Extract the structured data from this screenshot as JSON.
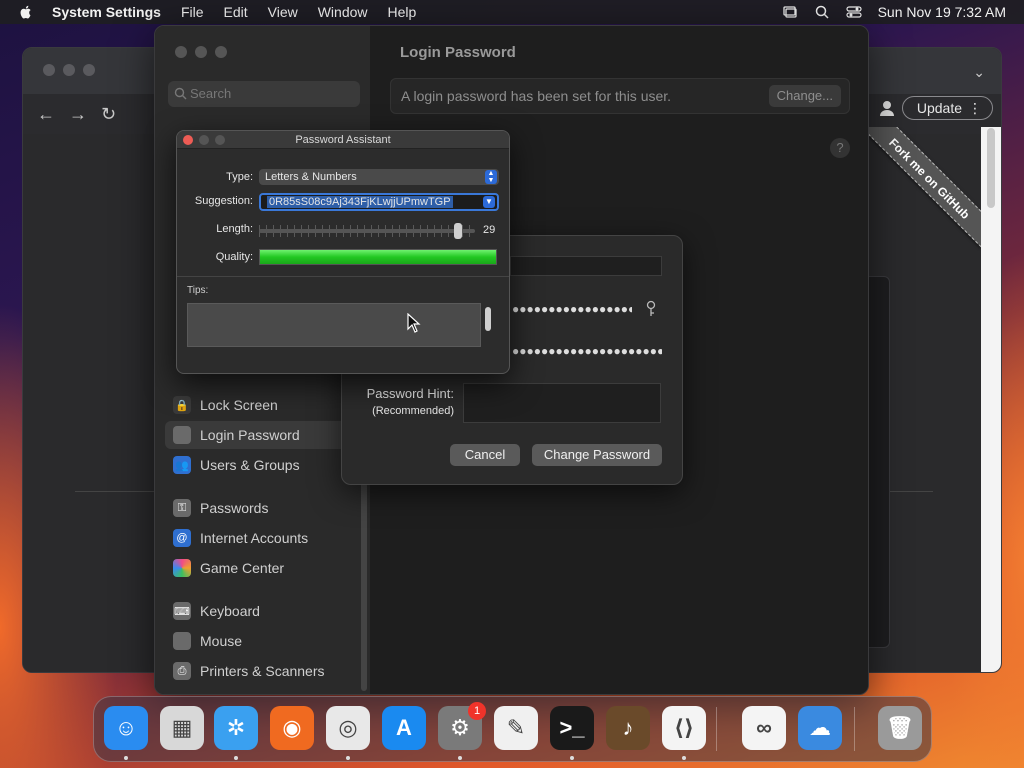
{
  "menubar": {
    "app_name": "System Settings",
    "items": [
      "File",
      "Edit",
      "View",
      "Window",
      "Help"
    ],
    "clock": "Sun Nov 19  7:32 AM"
  },
  "chrome": {
    "update_label": "Update",
    "ribbon_text": "Fork me on GitHub"
  },
  "settings": {
    "search_placeholder": "Search",
    "title": "Login Password",
    "info_text": "A login password has been set for this user.",
    "change_label": "Change...",
    "help_label": "?",
    "sidebar": [
      {
        "label": "Lock Screen",
        "icon": "lock-icon",
        "color": "#3a3a3a"
      },
      {
        "label": "Login Password",
        "icon": "key-icon",
        "color": "#6a6a6a",
        "selected": true
      },
      {
        "label": "Users & Groups",
        "icon": "users-icon",
        "color": "#2f6fd0"
      },
      {
        "label": "Passwords",
        "icon": "key-icon",
        "color": "#6a6a6a"
      },
      {
        "label": "Internet Accounts",
        "icon": "at-icon",
        "color": "#2f6fd0"
      },
      {
        "label": "Game Center",
        "icon": "game-center-icon",
        "color": "#d04a8a"
      },
      {
        "label": "Keyboard",
        "icon": "keyboard-icon",
        "color": "#6a6a6a"
      },
      {
        "label": "Mouse",
        "icon": "mouse-icon",
        "color": "#6a6a6a"
      },
      {
        "label": "Printers & Scanners",
        "icon": "printer-icon",
        "color": "#6a6a6a"
      }
    ]
  },
  "sheet": {
    "hint_label": "Password Hint:",
    "hint_sub": "(Recommended)",
    "new_password_dots": "●●●●●●●●●●●●●●●●●●●●●●●●●●●●●",
    "verify_dots": "●●●●●●●●●●●●●●●●●●●●●●●●●●●●●",
    "cancel_label": "Cancel",
    "change_password_label": "Change Password"
  },
  "assistant": {
    "title": "Password Assistant",
    "type_label": "Type:",
    "type_value": "Letters & Numbers",
    "suggestion_label": "Suggestion:",
    "suggestion_value": "0R85sS08c9Aj343FjKLwjjUPmwTGP",
    "length_label": "Length:",
    "length_value": "29",
    "length_fraction": 0.92,
    "quality_label": "Quality:",
    "quality_fraction": 1.0,
    "tips_label": "Tips:"
  },
  "dock": {
    "items": [
      {
        "name": "finder",
        "color": "#2a8cf0",
        "glyph": "☺",
        "dot": true
      },
      {
        "name": "launchpad",
        "color": "#d8d8d8",
        "glyph": "▦",
        "dot": false
      },
      {
        "name": "safari",
        "color": "#3aa0f0",
        "glyph": "✲",
        "dot": true
      },
      {
        "name": "firefox",
        "color": "#f06a20",
        "glyph": "◉",
        "dot": false
      },
      {
        "name": "chrome",
        "color": "#e8e8e8",
        "glyph": "◎",
        "dot": true
      },
      {
        "name": "app-store",
        "color": "#1a8af0",
        "glyph": "A",
        "dot": false
      },
      {
        "name": "system-settings",
        "color": "#7a7a7a",
        "glyph": "⚙",
        "dot": true,
        "badge": "1"
      },
      {
        "name": "textedit",
        "color": "#f0f0f0",
        "glyph": "✎",
        "dot": false
      },
      {
        "name": "terminal",
        "color": "#1a1a1a",
        "glyph": ">_",
        "dot": true
      },
      {
        "name": "garageband",
        "color": "#6a4a2a",
        "glyph": "♪",
        "dot": false
      },
      {
        "name": "vscode",
        "color": "#f4f4f4",
        "glyph": "⟨⟩",
        "dot": true
      },
      {
        "name": "visual-studio",
        "color": "#f4f4f4",
        "glyph": "∞",
        "dot": false
      },
      {
        "name": "weather",
        "color": "#3a8ae0",
        "glyph": "☁",
        "dot": false
      },
      {
        "name": "trash",
        "color": "#9a9a9a",
        "glyph": "🗑",
        "dot": false
      }
    ]
  }
}
